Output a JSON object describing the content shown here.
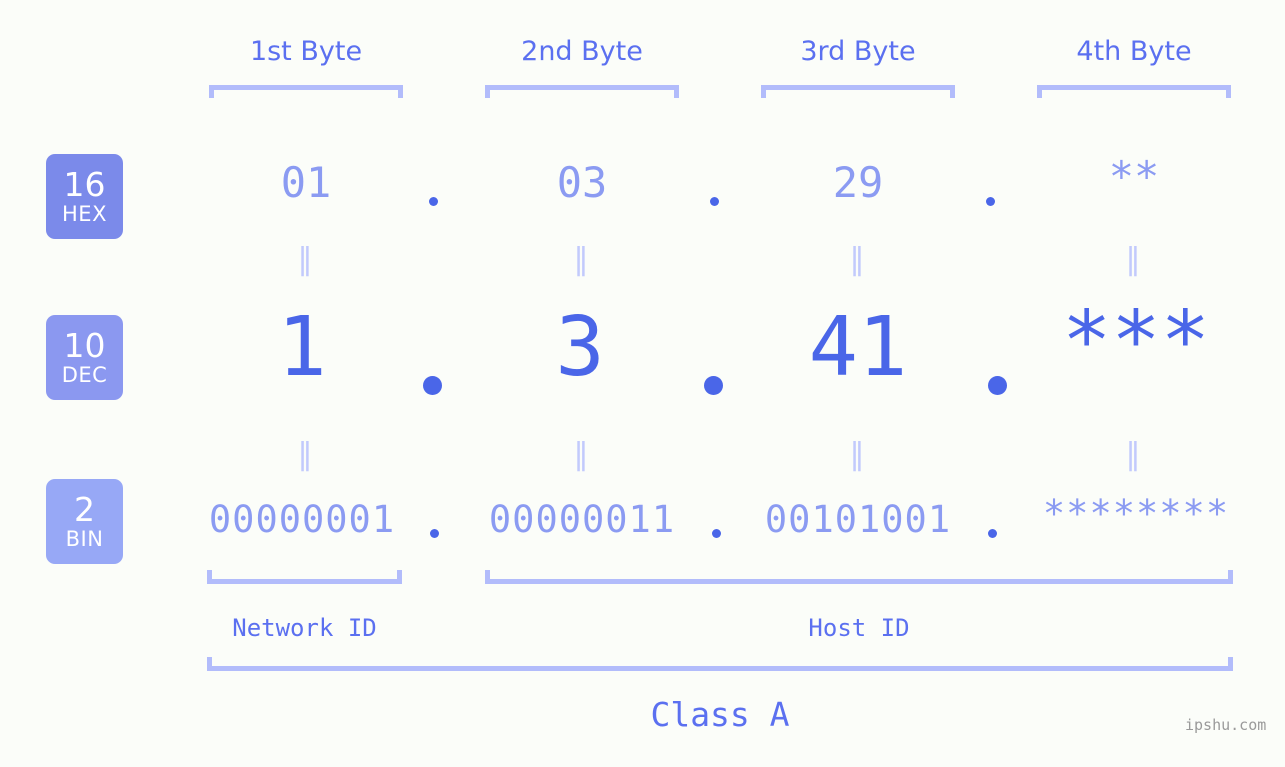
{
  "colors": {
    "background": "#fbfdf9",
    "accent_strong": "#4a66e8",
    "accent_label": "#5b70f0",
    "accent_light": "#8b9bf2",
    "bracket": "#b2bcfb",
    "eq_mark": "#c2cafc",
    "badge_hex": "#7b8aea",
    "badge_dec": "#8b98f0",
    "badge_bin": "#97a8f6",
    "watermark": "#9a9a9a"
  },
  "header": {
    "byte_labels": [
      "1st Byte",
      "2nd Byte",
      "3rd Byte",
      "4th Byte"
    ]
  },
  "bases": [
    {
      "number": "16",
      "name": "HEX"
    },
    {
      "number": "10",
      "name": "DEC"
    },
    {
      "number": "2",
      "name": "BIN"
    }
  ],
  "rows": {
    "hex": {
      "base_number": "16",
      "base_name": "HEX",
      "values": [
        "01",
        "03",
        "29",
        "**"
      ],
      "separator": "."
    },
    "dec": {
      "base_number": "10",
      "base_name": "DEC",
      "values": [
        "1",
        "3",
        "41",
        "***"
      ],
      "separator": "."
    },
    "bin": {
      "base_number": "2",
      "base_name": "BIN",
      "values": [
        "00000001",
        "00000011",
        "00101001",
        "********"
      ],
      "separator": "."
    }
  },
  "equals_marks": {
    "glyph": "‖",
    "count_per_row_gap": 4
  },
  "footer": {
    "network_id_label": "Network ID",
    "host_id_label": "Host ID",
    "class_label": "Class A",
    "watermark": "ipshu.com"
  }
}
